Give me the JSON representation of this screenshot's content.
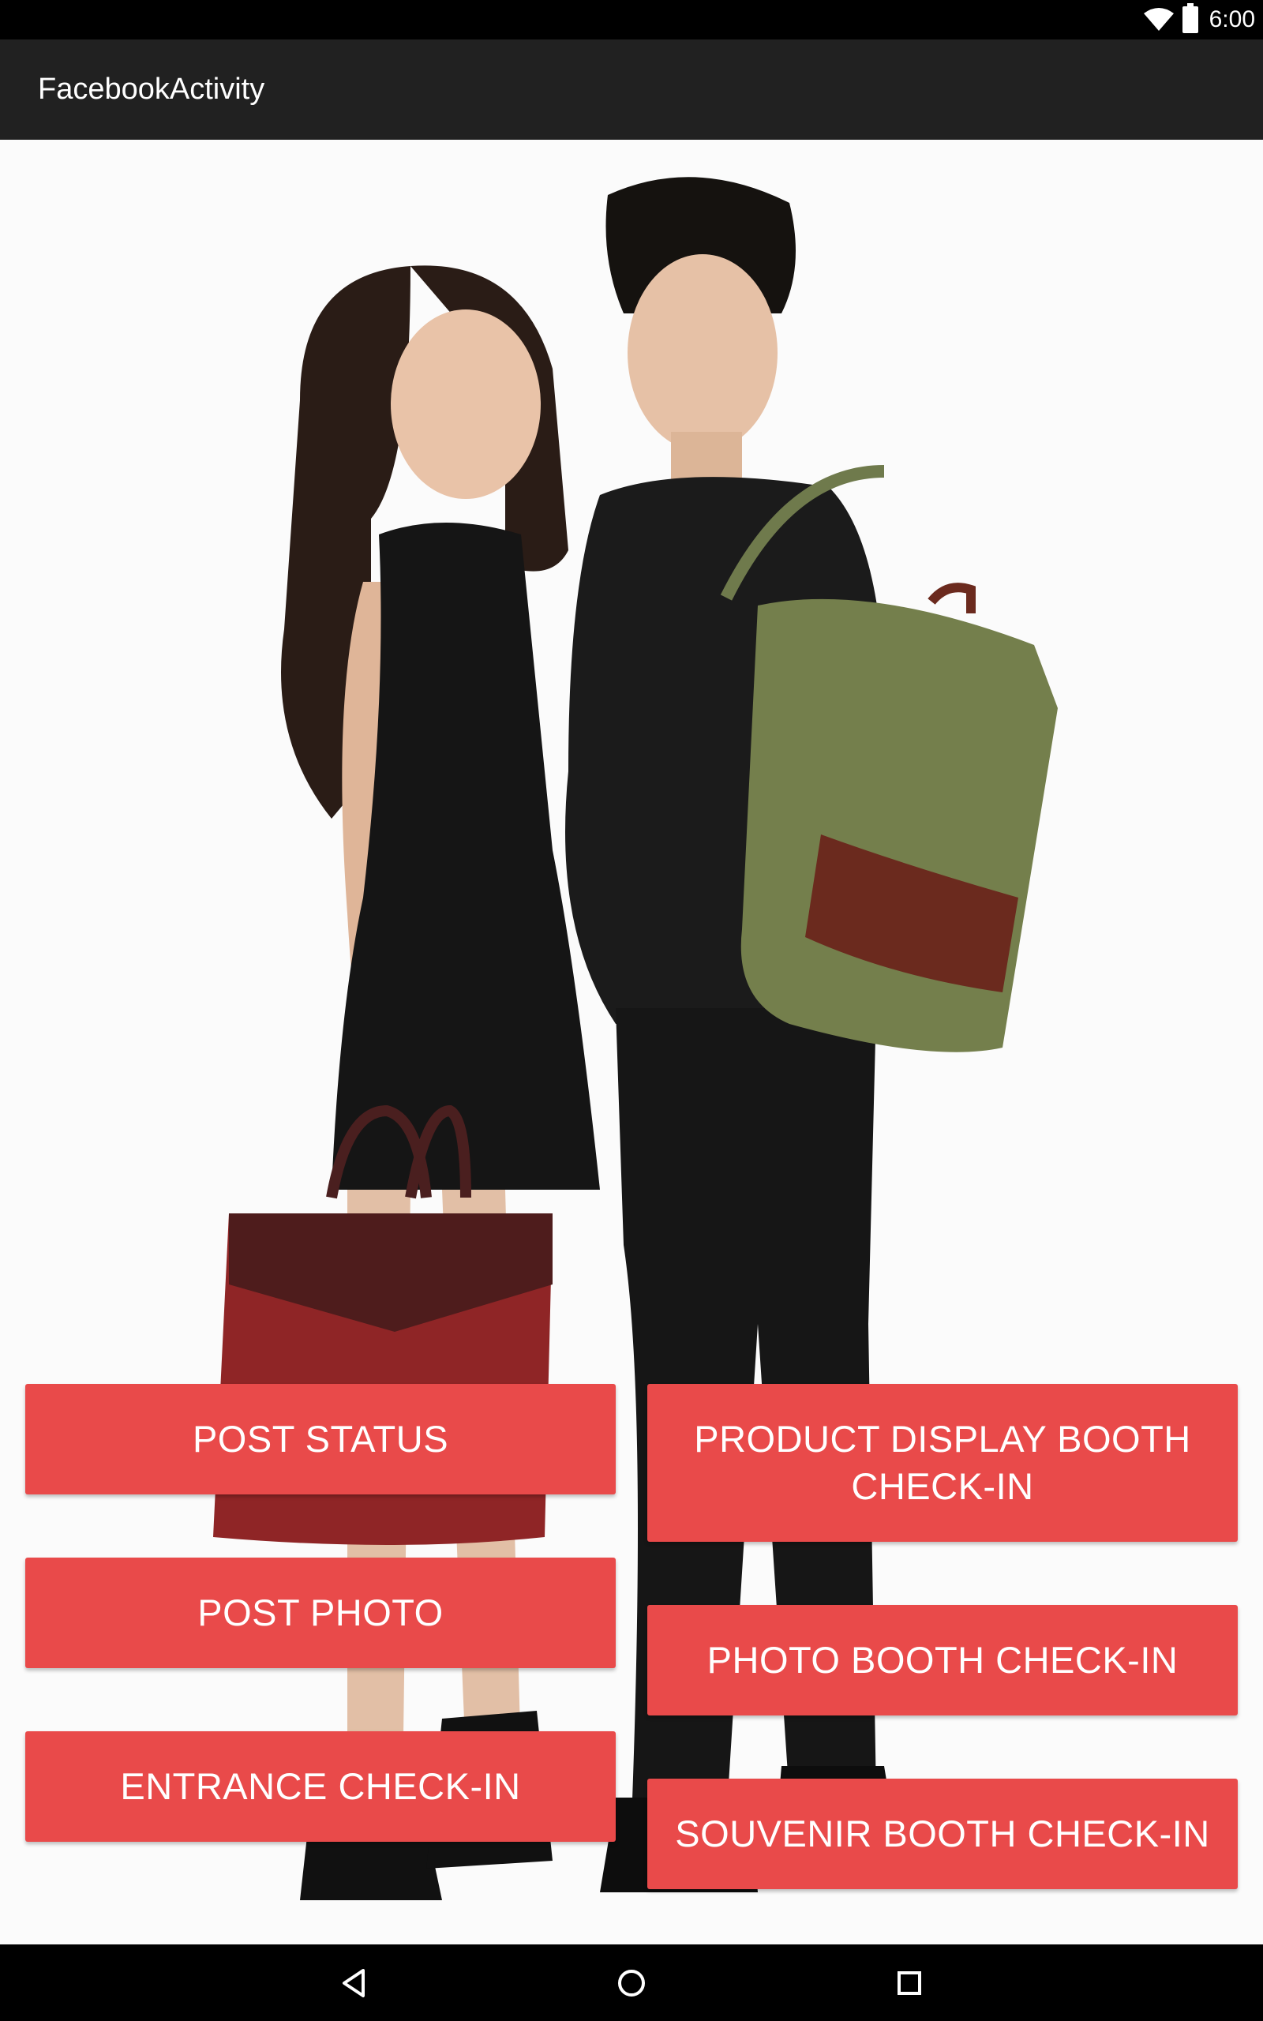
{
  "status_bar": {
    "time": "6:00",
    "wifi_icon": "wifi-icon",
    "battery_icon": "battery-icon"
  },
  "app": {
    "title": "FacebookActivity"
  },
  "buttons_left": [
    {
      "label": "POST STATUS"
    },
    {
      "label": "POST PHOTO"
    },
    {
      "label": "ENTRANCE CHECK-IN"
    }
  ],
  "buttons_right": [
    {
      "label": "PRODUCT DISPLAY BOOTH CHECK-IN"
    },
    {
      "label": "PHOTO BOOTH CHECK-IN"
    },
    {
      "label": "SOUVENIR BOOTH CHECK-IN"
    }
  ],
  "nav_bar": {
    "back_icon": "back-icon",
    "home_icon": "home-icon",
    "recents_icon": "recents-icon"
  },
  "colors": {
    "button": "#e94a4a",
    "action_bar": "#212121",
    "background": "#fbfbfb"
  }
}
